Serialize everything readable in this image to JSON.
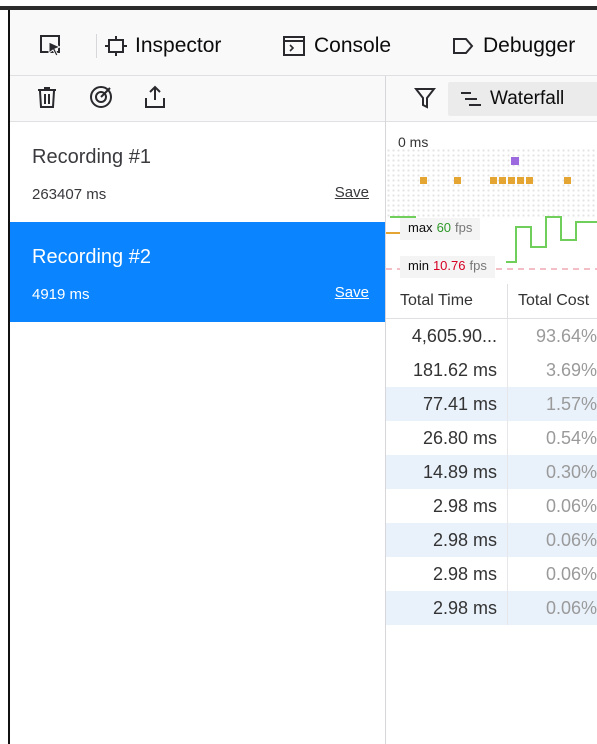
{
  "toolbar": {
    "tabs": [
      {
        "label": "Inspector",
        "icon": "inspector-icon"
      },
      {
        "label": "Console",
        "icon": "console-icon"
      },
      {
        "label": "Debugger",
        "icon": "debugger-icon"
      }
    ]
  },
  "left_toolbar": {
    "icons": [
      "trash-icon",
      "record-icon",
      "export-icon"
    ]
  },
  "recordings": [
    {
      "name": "Recording #1",
      "duration": "263407 ms",
      "save_label": "Save",
      "selected": false
    },
    {
      "name": "Recording #2",
      "duration": "4919 ms",
      "save_label": "Save",
      "selected": true
    }
  ],
  "view_toolbar": {
    "filter_icon": "filter-icon",
    "waterfall_label": "Waterfall"
  },
  "overview": {
    "time_label": "0 ms",
    "max_label": "max",
    "max_fps": "60",
    "min_label": "min",
    "min_fps": "10.76",
    "fps_unit": "fps"
  },
  "call_tree": {
    "columns": [
      "Total Time",
      "Total Cost"
    ],
    "rows": [
      {
        "time": "4,605.90...",
        "pct": "93.64%"
      },
      {
        "time": "181.62 ms",
        "pct": "3.69%"
      },
      {
        "time": "77.41 ms",
        "pct": "1.57%"
      },
      {
        "time": "26.80 ms",
        "pct": "0.54%"
      },
      {
        "time": "14.89 ms",
        "pct": "0.30%"
      },
      {
        "time": "2.98 ms",
        "pct": "0.06%"
      },
      {
        "time": "2.98 ms",
        "pct": "0.06%"
      },
      {
        "time": "2.98 ms",
        "pct": "0.06%"
      },
      {
        "time": "2.98 ms",
        "pct": "0.06%"
      }
    ]
  },
  "colors": {
    "accent": "#0a84ff",
    "fps_max": "#2e9a28",
    "fps_min": "#d70022",
    "marker_orange": "#e5a532",
    "marker_purple": "#9c6ade"
  }
}
